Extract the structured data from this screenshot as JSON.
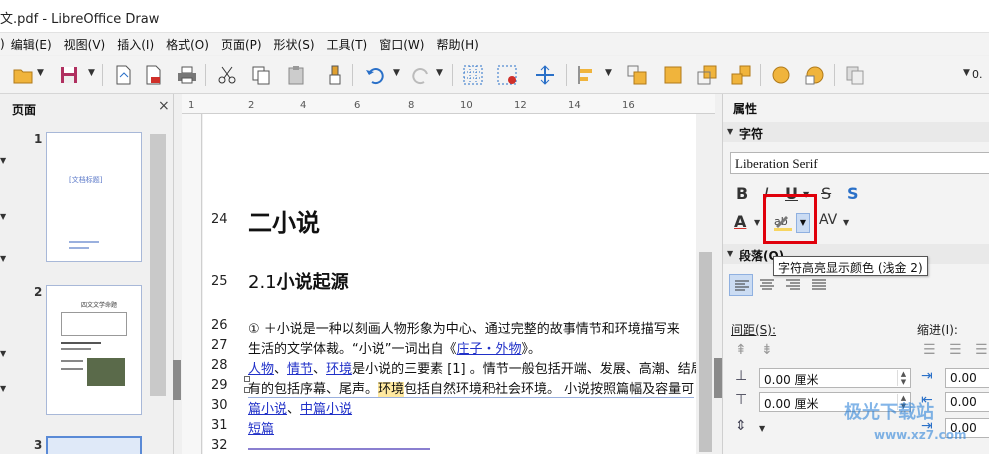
{
  "window": {
    "title": "文.pdf - LibreOffice Draw"
  },
  "menu": [
    "编辑(E)",
    "视图(V)",
    "插入(I)",
    "格式(O)",
    "页面(P)",
    "形状(S)",
    "工具(T)",
    "窗口(W)",
    "帮助(H)"
  ],
  "menu_prefix": ")",
  "pages_pane": {
    "title": "页面",
    "close_glyph": "×",
    "page_numbers": [
      "1",
      "2",
      "3"
    ],
    "thumb1_text": "[文档标题]",
    "thumb2_text": "四文文学命题"
  },
  "ruler": {
    "h_ticks": [
      "1",
      "2",
      "4",
      "6",
      "8",
      "10",
      "12",
      "14",
      "16"
    ]
  },
  "document": {
    "lines": [
      {
        "num": "24",
        "text": "二小说"
      },
      {
        "num": "25",
        "prefix": "2.1",
        "text": "小说起源"
      },
      {
        "num": "26",
        "text": "① ＋小说是一种以刻画人物形象为中心、通过完整的故事情节和环境描写来"
      },
      {
        "num": "27",
        "text": "生活的文学体裁。“小说”一词出自《",
        "link": "庄子・外物",
        "after": "》。"
      },
      {
        "num": "28",
        "l1": "人物",
        "s1": "、",
        "l2": "情节",
        "s2": "、",
        "l3": "环境",
        "rest": "是小说的三要素 [1] 。情节一般包括开端、发展、高潮、结局四"
      },
      {
        "num": "29",
        "pre": "有的包括序幕、尾声。",
        "hl": "环境",
        "rest": "包括自然环境和社会环境。 小说按照篇幅及容量可"
      },
      {
        "num": "30",
        "l1": "篇小说",
        "s1": "、",
        "l2": "中篇小说"
      },
      {
        "num": "31",
        "l1": "短篇"
      },
      {
        "num": "32",
        "text": ""
      }
    ]
  },
  "sidebar": {
    "title": "属性",
    "char_section": "字符",
    "font_name": "Liberation Serif",
    "format_buttons": {
      "bold": "B",
      "italic": "I",
      "underline": "U",
      "strike": "S",
      "shadow": "S",
      "font_color": "A",
      "spacing": "AV"
    },
    "para_section": "段落(Q)",
    "tooltip": "字符高亮显示颜色 (浅金 2)",
    "spacing_label": "间距(S):",
    "indent_label": "缩进(I):",
    "above_value": "0.00 厘米",
    "below_value": "0.00 厘米",
    "indent_value_1": "0.00",
    "indent_value_2": "0.00",
    "indent_value_3": "0.00"
  },
  "watermark": {
    "line1": "极光下载站",
    "line2": "www.xz7.com"
  },
  "colors": {
    "highlight_red": "#e0000b",
    "tooltip_bg": "#ffffff",
    "link_blue": "#2030c8",
    "highlight_gold": "#ffe9a0"
  }
}
